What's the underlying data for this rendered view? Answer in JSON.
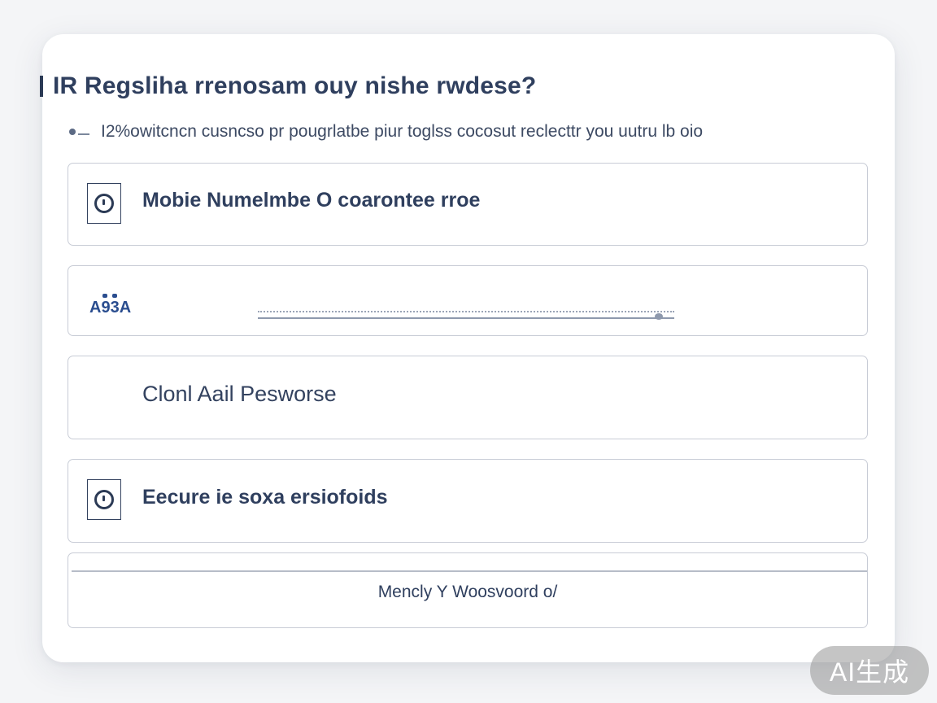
{
  "header": {
    "title": "IR Regsliha rrenosam ouy nishe rwdese?",
    "subtitle": "I2%owitcncn cusncso pr pougrlatbe piur toglss cocosut reclecttr you uutru lb oio"
  },
  "options": [
    {
      "label": "Mobie Numelmbe  O  coarontee rroe",
      "icon": "clock-icon"
    },
    {
      "code_label": "A93A",
      "input_value": ""
    },
    {
      "label": "Clonl Aail Pesworse"
    },
    {
      "label": "Eecure ie soxa ersiofoids",
      "icon": "clock-icon"
    },
    {
      "link_label": "Mencly Y Woosvoord  o/"
    }
  ],
  "watermark": {
    "label": "AI生成"
  }
}
